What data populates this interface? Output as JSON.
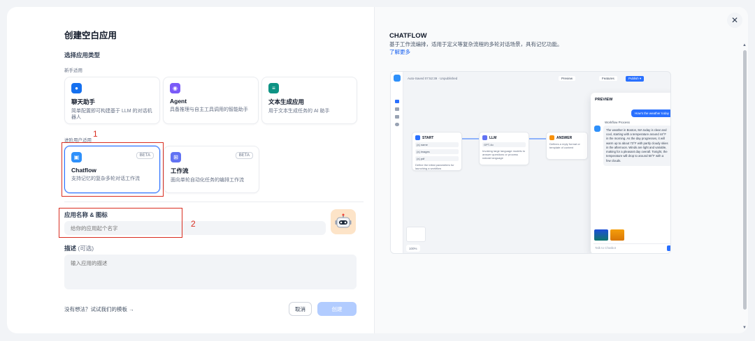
{
  "modal": {
    "title": "创建空白应用",
    "close_icon": "close-icon"
  },
  "app_type": {
    "label": "选择应用类型",
    "beginner_label": "新手适用",
    "advanced_label": "进阶用户适用",
    "cards": [
      {
        "name": "聊天助手",
        "desc": "简单配置即可构建基于 LLM 的对话机器人",
        "icon": "chat-bot-icon",
        "color": "#1570ef"
      },
      {
        "name": "Agent",
        "desc": "具备推理与自主工具调用的智能助手",
        "icon": "agent-icon",
        "color": "#7a5af8"
      },
      {
        "name": "文本生成应用",
        "desc": "用于文本生成任务的 AI 助手",
        "icon": "text-generation-icon",
        "color": "#0e9384"
      },
      {
        "name": "Chatflow",
        "desc": "支持记忆的复杂多轮对话工作流",
        "icon": "chatflow-icon",
        "color": "#2e90fa",
        "badge": "BETA"
      },
      {
        "name": "工作流",
        "desc": "面向单轮自动化任务的编排工作流",
        "icon": "workflow-icon",
        "color": "#6172f3",
        "badge": "BETA"
      }
    ]
  },
  "annotations": {
    "one": "1",
    "two": "2"
  },
  "name_field": {
    "label": "应用名称 & 图标",
    "placeholder": "给你的应用起个名字"
  },
  "desc_field": {
    "label": "描述",
    "optional": "(可选)",
    "placeholder": "输入应用的描述"
  },
  "footer": {
    "hint": "没有想法？试试我们的模板 →",
    "cancel": "取消",
    "create": "创建"
  },
  "preview": {
    "title": "CHATFLOW",
    "desc": "基于工作流编排，适用于定义等复杂流程的多轮对话场景，具有记忆功能。",
    "learn_more": "了解更多",
    "mock": {
      "top_status": "Auto-Saved 07:52:39 · Unpublished",
      "toolbar_preview": "Preview",
      "toolbar_features": "Features",
      "toolbar_publish": "Publish ▾",
      "node_start": "START",
      "start_rows": [
        "{x} name",
        "{x} images",
        "{x} pdf"
      ],
      "start_text": "Define the initial parameters for launching a workflow",
      "node_llm": "LLM",
      "llm_model": "GPT-4o",
      "llm_text": "Invoking large language models to answer questions or process natural language",
      "node_answer": "ANSWER",
      "answer_text": "Defines a reply format or template of content",
      "panel_title": "PREVIEW",
      "user_msg": "How's the weather today",
      "bot_name": "Workflow Process",
      "bot_msg": "The weather in Boston, MA today is clear and cool, starting with a temperature around 44°F in the morning. As the day progresses, it will warm up to about 73°F with partly cloudy skies in the afternoon. Winds are light and variable, making for a pleasant day overall. Tonight, the temperature will drop to around 50°F with a few clouds.",
      "input_placeholder": "Talk to Chatbot",
      "zoom": "100%"
    }
  }
}
